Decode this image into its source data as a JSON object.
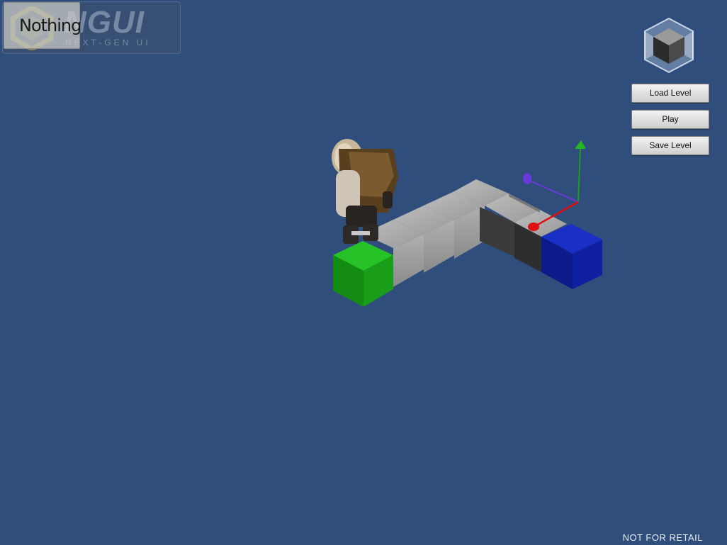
{
  "logo": {
    "title": "NGUI",
    "subtitle": "NEXT-GEN UI"
  },
  "toolbar": {
    "selected_tool": "Nothing"
  },
  "menu": {
    "load_label": "Load Level",
    "play_label": "Play",
    "save_label": "Save Level"
  },
  "footer": {
    "note": "NOT FOR RETAIL"
  },
  "colors": {
    "background": "#2f4e7b",
    "start_tile": "#1aa81a",
    "goal_tile": "#1424b0",
    "gizmo_x": "#e01010",
    "gizmo_y": "#18a018",
    "gizmo_z": "#6a3ad8"
  },
  "icons": {
    "editor_cube": "cube-icon",
    "logo": "ngui-logo-icon"
  }
}
